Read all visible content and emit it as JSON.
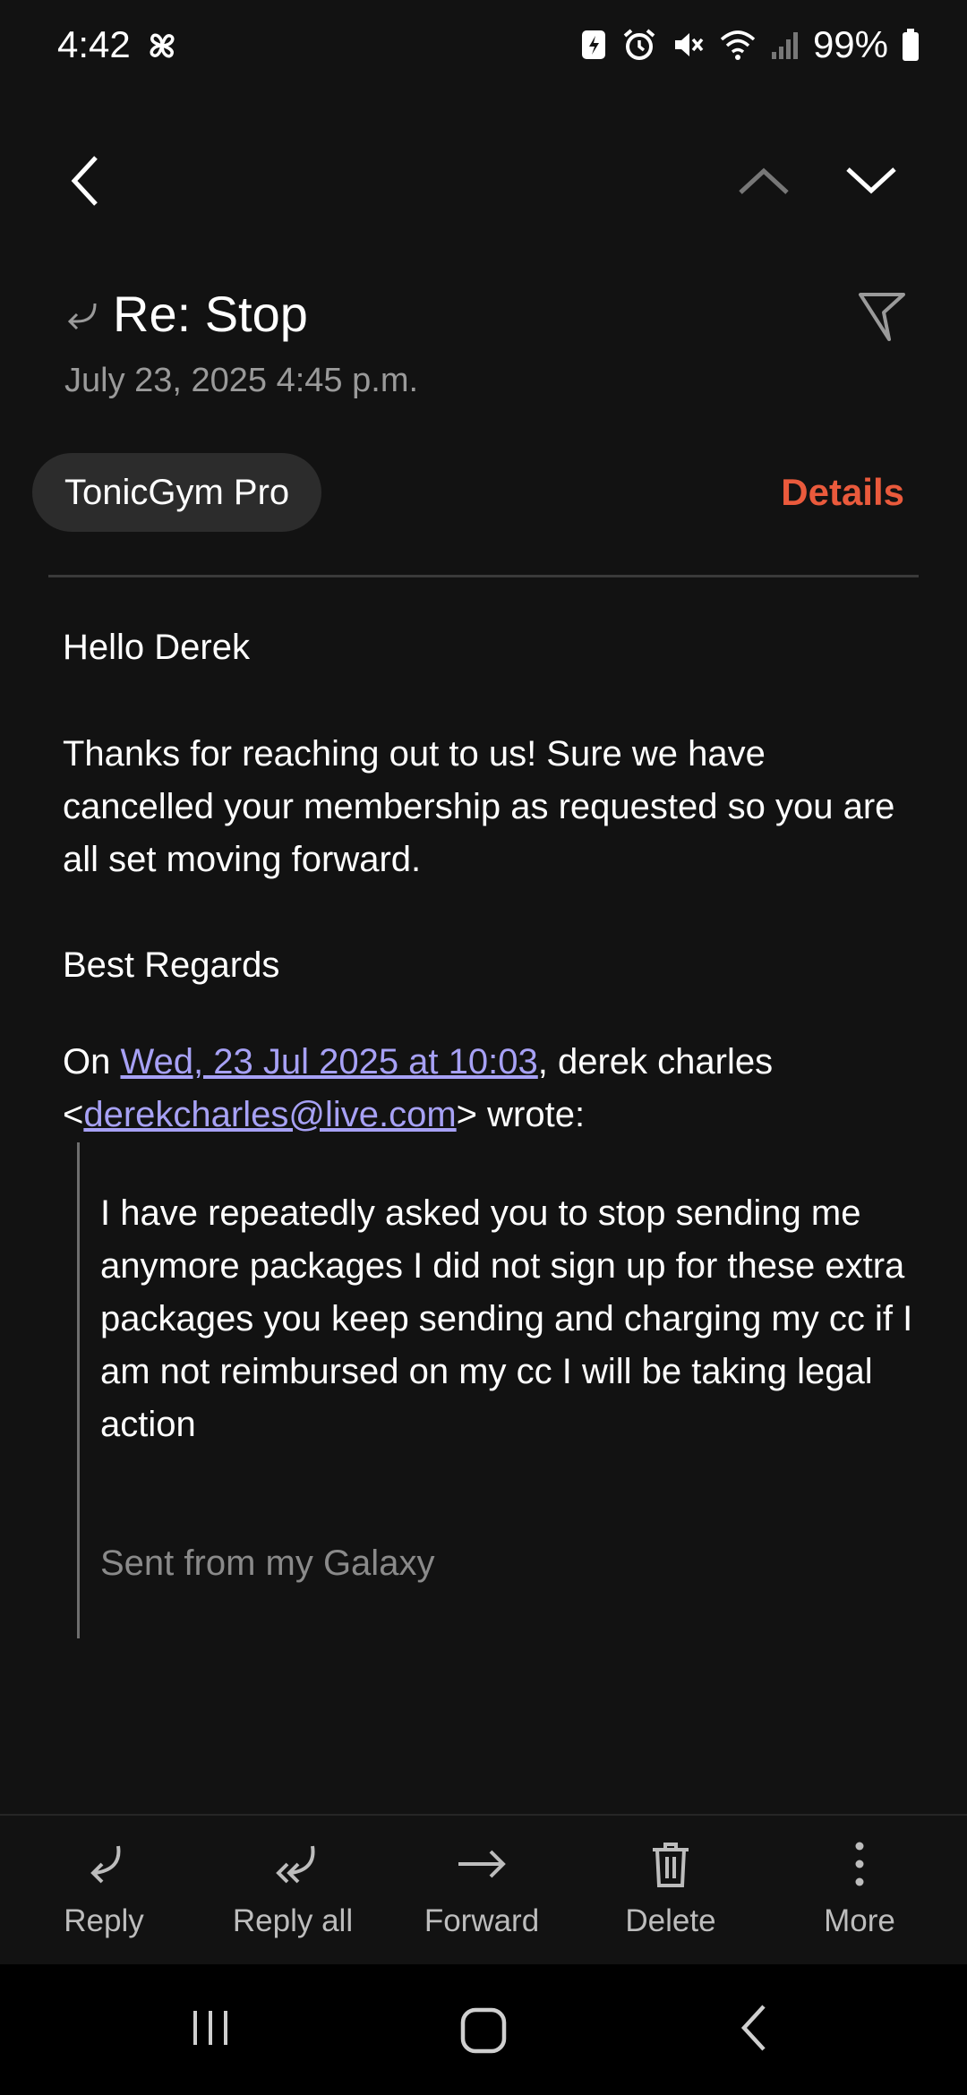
{
  "status_bar": {
    "time": "4:42",
    "battery": "99%"
  },
  "email": {
    "subject": "Re: Stop",
    "date": "July 23, 2025  4:45 p.m.",
    "sender": "TonicGym Pro",
    "details_label": "Details",
    "greeting": "Hello Derek",
    "paragraph": "Thanks for reaching out to us! Sure we have cancelled your membership as requested so you are all set moving forward.",
    "signoff": "Best Regards",
    "quote_header": {
      "on": "On ",
      "date_link": "Wed, 23 Jul 2025 at 10:03",
      "author": ", derek charles",
      "lt": "<",
      "email_link": "derekcharles@live.com",
      "wrote": "> wrote:"
    },
    "quoted_text": "I have repeatedly asked you to stop sending me anymore packages I did not sign up for these extra packages you keep sending and charging my cc if I am not reimbursed on my cc I will be taking legal action",
    "quoted_signature": "Sent from my Galaxy"
  },
  "actions": {
    "reply": "Reply",
    "reply_all": "Reply all",
    "forward": "Forward",
    "delete": "Delete",
    "more": "More"
  },
  "colors": {
    "background": "#121212",
    "accent": "#ea5a3c",
    "link": "#a7a1f5"
  }
}
